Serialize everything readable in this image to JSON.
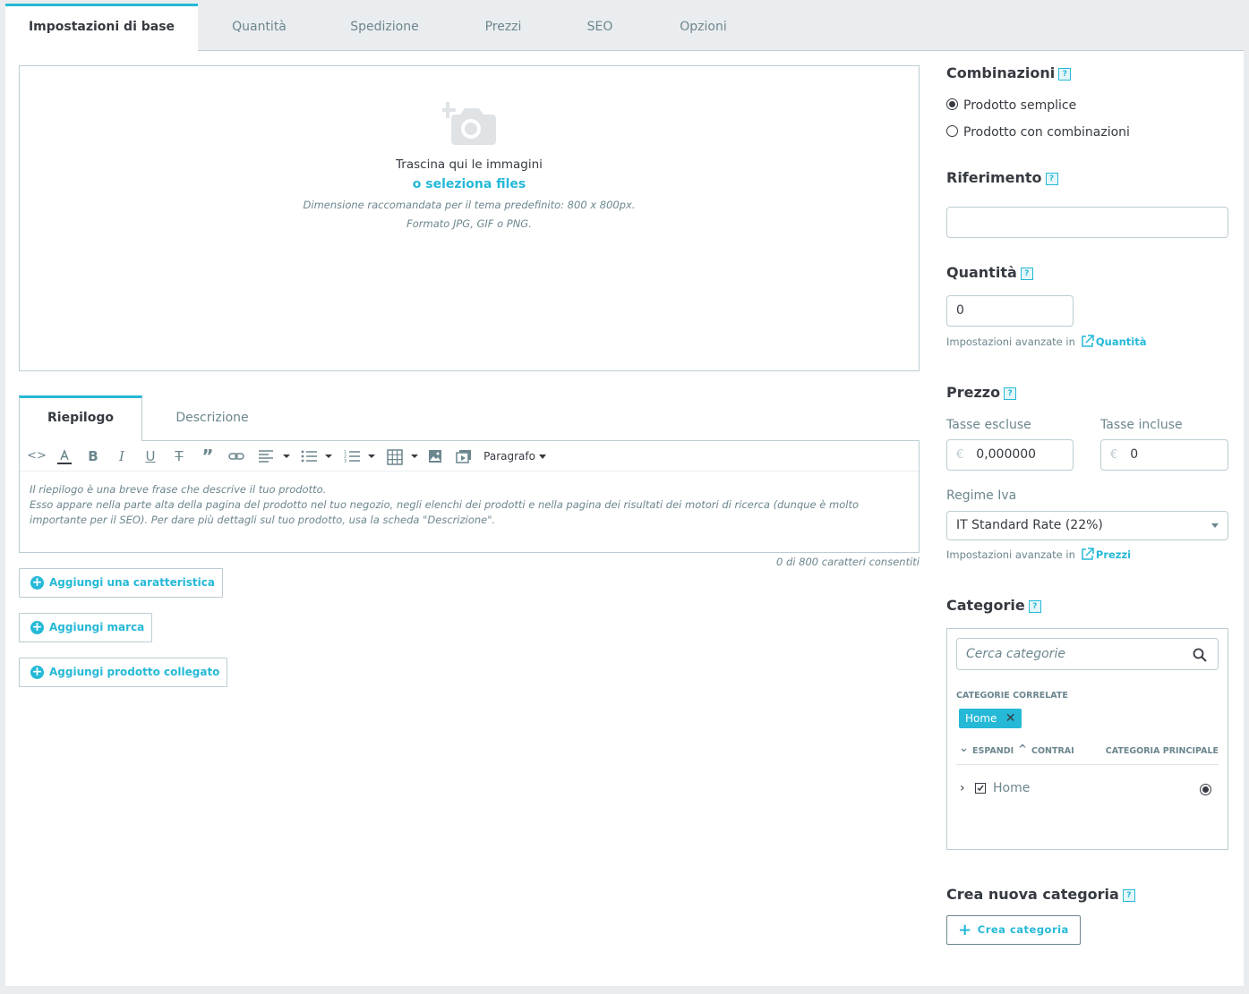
{
  "tabs": [
    "Impostazioni di base",
    "Quantità",
    "Spedizione",
    "Prezzi",
    "SEO",
    "Opzioni"
  ],
  "dropzone": {
    "line1": "Trascina qui le immagini",
    "line2": "o seleziona files",
    "line3": "Dimensione raccomandata per il tema predefinito: 800 x 800px.",
    "line4": "Formato JPG, GIF o PNG."
  },
  "editor": {
    "tab_summary": "Riepilogo",
    "tab_description": "Descrizione",
    "paragraph": "Paragrafo",
    "placeholder_line1": "Il riepilogo è una breve frase che descrive il tuo prodotto.",
    "placeholder_line2": "Esso appare nella parte alta della pagina del prodotto nel tuo negozio, negli elenchi dei prodotti e nella pagina dei risultati dei motori di ricerca (dunque è molto importante per il SEO). Per dare più dettagli sul tuo prodotto, usa la scheda \"Descrizione\".",
    "char_count": "0 di 800 caratteri consentiti"
  },
  "buttons": {
    "add_feature": "Aggiungi una caratteristica",
    "add_brand": "Aggiungi marca",
    "add_related": "Aggiungi prodotto collegato"
  },
  "combinations": {
    "title": "Combinazioni",
    "simple": "Prodotto semplice",
    "with_combinations": "Prodotto con combinazioni"
  },
  "reference": {
    "title": "Riferimento",
    "value": ""
  },
  "quantity": {
    "title": "Quantità",
    "value": "0",
    "advanced": "Impostazioni avanzate in",
    "advanced_link": "Quantità"
  },
  "price": {
    "title": "Prezzo",
    "tax_excl_label": "Tasse escluse",
    "tax_incl_label": "Tasse incluse",
    "currency": "€",
    "tax_excl_value": "0,000000",
    "tax_incl_value": "0",
    "vat_label": "Regime Iva",
    "vat_value": "IT Standard Rate (22%)",
    "advanced": "Impostazioni avanzate in",
    "advanced_link": "Prezzi"
  },
  "categories": {
    "title": "Categorie",
    "search_placeholder": "Cerca categorie",
    "related_title": "CATEGORIE CORRELATE",
    "chip": "Home",
    "expand": "ESPANDI",
    "collapse": "CONTRAI",
    "main_category": "CATEGORIA PRINCIPALE",
    "tree_item": "Home"
  },
  "new_category": {
    "title": "Crea nuova categoria",
    "button": "Crea categoria"
  },
  "help_glyph": "?",
  "colors": {
    "accent": "#25b9d7",
    "text": "#363a41",
    "muted": "#6c868e",
    "border": "#bbcdd2"
  }
}
